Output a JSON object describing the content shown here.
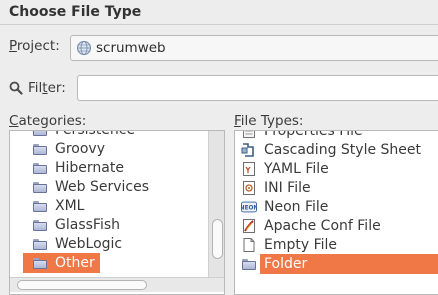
{
  "dialog": {
    "title": "Choose File Type"
  },
  "project": {
    "label": "Project:",
    "mnemonic": "P",
    "rest": "roject:",
    "value": "scrumweb",
    "icon": "globe-icon"
  },
  "filter": {
    "label_pre": "Fil",
    "mnemonic": "t",
    "label_post": "er:",
    "value": "",
    "icon": "search-icon"
  },
  "categories": {
    "label_pre": "",
    "mnemonic": "C",
    "label_post": "ategories:",
    "items": [
      {
        "label": "Persistence",
        "icon": "folder-icon"
      },
      {
        "label": "Groovy",
        "icon": "folder-icon"
      },
      {
        "label": "Hibernate",
        "icon": "folder-icon"
      },
      {
        "label": "Web Services",
        "icon": "folder-icon"
      },
      {
        "label": "XML",
        "icon": "folder-icon"
      },
      {
        "label": "GlassFish",
        "icon": "folder-icon"
      },
      {
        "label": "WebLogic",
        "icon": "folder-icon"
      },
      {
        "label": "Other",
        "icon": "folder-icon",
        "selected": true
      }
    ]
  },
  "file_types": {
    "label_pre": "",
    "mnemonic": "F",
    "label_post": "ile Types:",
    "items": [
      {
        "label": "Properties File",
        "icon": "properties-file-icon"
      },
      {
        "label": "Cascading Style Sheet",
        "icon": "css-icon"
      },
      {
        "label": "YAML File",
        "icon": "yaml-file-icon"
      },
      {
        "label": "INI File",
        "icon": "ini-file-icon"
      },
      {
        "label": "Neon File",
        "icon": "neon-file-icon"
      },
      {
        "label": "Apache Conf File",
        "icon": "apache-conf-icon"
      },
      {
        "label": "Empty File",
        "icon": "empty-file-icon"
      },
      {
        "label": "Folder",
        "icon": "folder-icon",
        "selected": true
      }
    ]
  },
  "colors": {
    "selection": "#f07746",
    "background": "#ededed"
  }
}
